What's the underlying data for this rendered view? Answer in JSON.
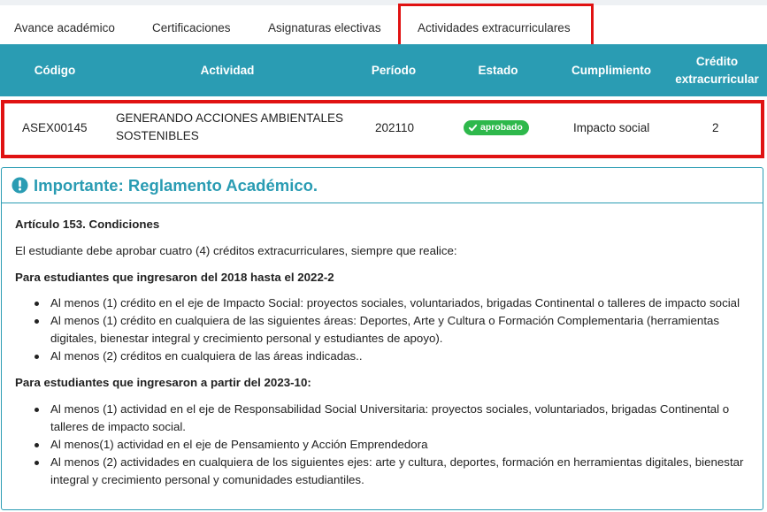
{
  "tabs": [
    {
      "label": "Avance académico"
    },
    {
      "label": "Certificaciones"
    },
    {
      "label": "Asignaturas electivas"
    },
    {
      "label": "Actividades extracurriculares",
      "active": true
    }
  ],
  "table": {
    "headers": {
      "codigo": "Código",
      "actividad": "Actividad",
      "periodo": "Período",
      "estado": "Estado",
      "cumplimiento": "Cumplimiento",
      "credito_l1": "Crédito",
      "credito_l2": "extracurricular"
    },
    "rows": [
      {
        "codigo": "ASEX00145",
        "actividad": "GENERANDO ACCIONES AMBIENTALES SOSTENIBLES",
        "periodo": "202110",
        "estado": "aprobado",
        "cumplimiento": "Impacto social",
        "credito": "2"
      }
    ]
  },
  "notice": {
    "title": "Importante: Reglamento Académico.",
    "article": "Artículo 153. Condiciones",
    "intro": "El estudiante debe aprobar cuatro (4) créditos extracurriculares, siempre que realice:",
    "group1_title": "Para estudiantes que ingresaron del 2018 hasta el 2022-2",
    "group1_items": [
      "Al menos (1) crédito en el eje de Impacto Social: proyectos sociales, voluntariados, brigadas Continental o talleres de impacto social",
      "Al menos (1) crédito en cualquiera de las siguientes áreas: Deportes, Arte y Cultura o Formación Complementaria (herramientas digitales, bienestar integral y crecimiento personal y estudiantes de apoyo).",
      "Al menos (2) créditos en cualquiera de las áreas indicadas.."
    ],
    "group2_title": "Para estudiantes que ingresaron a partir del 2023-10:",
    "group2_items": [
      "Al menos (1) actividad en el eje de Responsabilidad Social Universitaria: proyectos sociales, voluntariados, brigadas Continental o talleres de impacto social.",
      "Al menos(1) actividad en el eje de Pensamiento y Acción Emprendedora",
      "Al menos (2) actividades en cualquiera de los siguientes ejes: arte y cultura, deportes, formación en herramientas digitales, bienestar integral y crecimiento personal y comunidades estudiantiles."
    ]
  },
  "colors": {
    "header_bg": "#2a9cb3",
    "highlight": "#e01212",
    "badge_green": "#2eb84b"
  },
  "icons": {
    "badge": "check-icon",
    "notice": "exclamation-circle-icon"
  }
}
